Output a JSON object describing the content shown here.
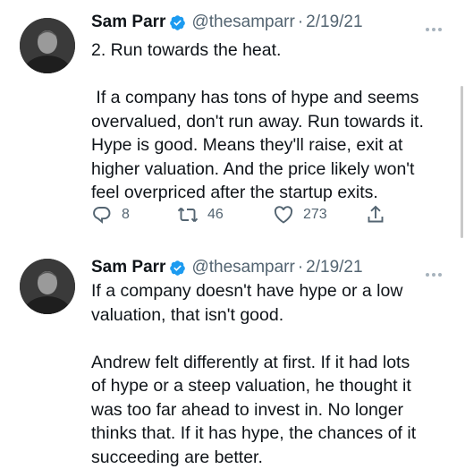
{
  "tweets": [
    {
      "author": {
        "name": "Sam Parr",
        "handle": "@thesamparr",
        "verified_icon": "verified-badge-icon"
      },
      "separator": "·",
      "date": "2/19/21",
      "text": "2. Run towards the heat.\n\n If a company has tons of hype and seems\noverva​lued, don't run away. Run towards it.\nHype is good. Means they'll raise, exit at\nhigher valuation. And the price likely won't\nfeel overpriced after the startup exits.",
      "actions": {
        "replies": "8",
        "retweets": "46",
        "likes": "273"
      }
    },
    {
      "author": {
        "name": "Sam Parr",
        "handle": "@thesamparr",
        "verified_icon": "verified-badge-icon"
      },
      "separator": "·",
      "date": "2/19/21",
      "text": "If a company doesn't have hype or a low\nvaluation, that isn't good.\n\nAndrew felt differently at first. If it had lots\nof hype or a steep valuation, he thought it\nwas too far ahead to invest in. No longer\nthinks that. If it has hype, the chances of it\nsucceeding are better."
    }
  ],
  "colors": {
    "text": "#0f1419",
    "secondary": "#536471",
    "verified": "#1d9bf0"
  }
}
